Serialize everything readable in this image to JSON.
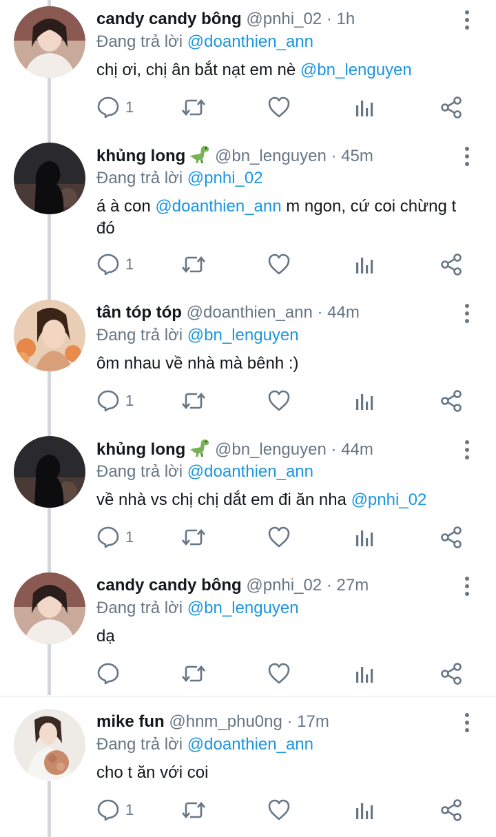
{
  "replying_label": "Đang trả lời",
  "tweets": [
    {
      "display_name": "candy candy bông",
      "handle": "@pnhi_02",
      "time": "1h",
      "replying_to": "@doanthien_ann",
      "text_parts": [
        "chị ơi, chị ân bắt nạt em nè ",
        "@bn_lenguyen"
      ],
      "reply_count": "1"
    },
    {
      "display_name": "khủng long",
      "emoji": "dinosaur",
      "handle": "@bn_lenguyen",
      "time": "45m",
      "replying_to": "@pnhi_02",
      "text_parts": [
        "á à con ",
        "@doanthien_ann",
        " m ngon, cứ coi chừng t đó"
      ],
      "reply_count": "1"
    },
    {
      "display_name": "tân tóp tóp",
      "handle": "@doanthien_ann",
      "time": "44m",
      "replying_to": "@bn_lenguyen",
      "text_parts": [
        "ôm nhau về nhà mà bênh :)"
      ],
      "reply_count": "1"
    },
    {
      "display_name": "khủng long",
      "emoji": "dinosaur",
      "handle": "@bn_lenguyen",
      "time": "44m",
      "replying_to": "@doanthien_ann",
      "text_parts": [
        "về nhà vs chị chị dắt em đi ăn nha ",
        "@pnhi_02"
      ],
      "reply_count": "1"
    },
    {
      "display_name": "candy candy bông",
      "handle": "@pnhi_02",
      "time": "27m",
      "replying_to": "@bn_lenguyen",
      "text_parts": [
        "dạ"
      ],
      "reply_count": ""
    },
    {
      "display_name": "mike fun",
      "handle": "@hnm_phu0ng",
      "time": "17m",
      "replying_to": "@doanthien_ann",
      "text_parts": [
        "cho t ăn với coi"
      ],
      "reply_count": "1"
    }
  ],
  "icons": {
    "reply": "reply-icon",
    "retweet": "retweet-icon",
    "like": "heart-icon",
    "stats": "stats-icon",
    "share": "share-icon",
    "more": "more-vertical-icon"
  },
  "colors": {
    "mention": "#1b95e0",
    "secondary_text": "#687684",
    "primary_text": "#14171a",
    "icon": "#687684",
    "thread_line": "#d3d6da"
  }
}
